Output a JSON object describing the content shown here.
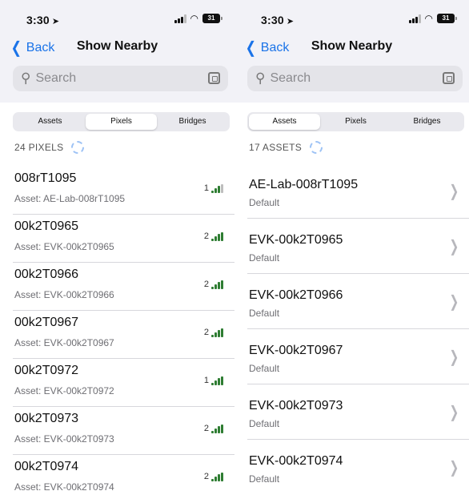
{
  "left": {
    "status": {
      "time": "3:30",
      "battery": "31"
    },
    "nav": {
      "back": "Back",
      "title": "Show Nearby"
    },
    "search": {
      "placeholder": "Search"
    },
    "tabs": [
      {
        "label": "Assets",
        "active": false
      },
      {
        "label": "Pixels",
        "active": true
      },
      {
        "label": "Bridges",
        "active": false
      }
    ],
    "count": "24 PIXELS",
    "rows": [
      {
        "title": "008rT1095",
        "subtitle": "Asset: AE-Lab-008rT1095",
        "rssi": "1",
        "bars": 3
      },
      {
        "title": "00k2T0965",
        "subtitle": "Asset: EVK-00k2T0965",
        "rssi": "2",
        "bars": 4
      },
      {
        "title": "00k2T0966",
        "subtitle": "Asset: EVK-00k2T0966",
        "rssi": "2",
        "bars": 4
      },
      {
        "title": "00k2T0967",
        "subtitle": "Asset: EVK-00k2T0967",
        "rssi": "2",
        "bars": 4
      },
      {
        "title": "00k2T0972",
        "subtitle": "Asset: EVK-00k2T0972",
        "rssi": "1",
        "bars": 4
      },
      {
        "title": "00k2T0973",
        "subtitle": "Asset: EVK-00k2T0973",
        "rssi": "2",
        "bars": 4
      },
      {
        "title": "00k2T0974",
        "subtitle": "Asset: EVK-00k2T0974",
        "rssi": "2",
        "bars": 4
      }
    ]
  },
  "right": {
    "status": {
      "time": "3:30",
      "battery": "31"
    },
    "nav": {
      "back": "Back",
      "title": "Show Nearby"
    },
    "search": {
      "placeholder": "Search"
    },
    "tabs": [
      {
        "label": "Assets",
        "active": true
      },
      {
        "label": "Pixels",
        "active": false
      },
      {
        "label": "Bridges",
        "active": false
      }
    ],
    "count": "17 ASSETS",
    "rows": [
      {
        "title": "AE-Lab-008rT1095",
        "subtitle": "Default"
      },
      {
        "title": "EVK-00k2T0965",
        "subtitle": "Default"
      },
      {
        "title": "EVK-00k2T0966",
        "subtitle": "Default"
      },
      {
        "title": "EVK-00k2T0967",
        "subtitle": "Default"
      },
      {
        "title": "EVK-00k2T0973",
        "subtitle": "Default"
      },
      {
        "title": "EVK-00k2T0974",
        "subtitle": "Default"
      }
    ]
  },
  "icons": {
    "back": "chevron-left-icon",
    "search": "magnifier-icon",
    "scan": "scan-icon",
    "spinner": "activity-spinner-icon",
    "row_chevron": "chevron-right-icon",
    "signal": "signal-bars-icon"
  },
  "colors": {
    "accent": "#1a73e8",
    "signal_good": "#2e7d32",
    "header_bg": "#f2f2f7"
  }
}
